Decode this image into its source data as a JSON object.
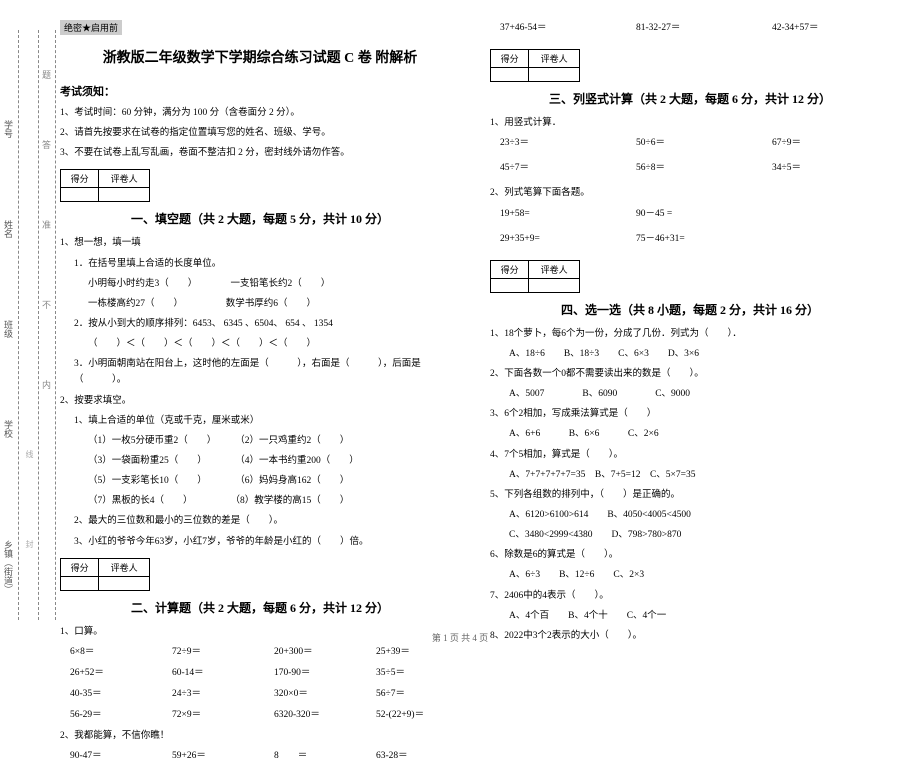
{
  "margin": {
    "township": "乡镇（街道）",
    "school": "学校",
    "class": "班级",
    "name": "姓名",
    "id": "学号",
    "inner": "内",
    "no": "不",
    "zhun": "准",
    "da": "答",
    "ti": "题",
    "feng": "封",
    "xian": "线"
  },
  "secret": "绝密★启用前",
  "title": "浙教版二年级数学下学期综合练习试题 C 卷  附解析",
  "instructions_title": "考试须知：",
  "instructions": [
    "1、考试时间：60 分钟，满分为 100 分（含卷面分 2 分）。",
    "2、请首先按要求在试卷的指定位置填写您的姓名、班级、学号。",
    "3、不要在试卷上乱写乱画，卷面不整洁扣 2 分，密封线外请勿作答。"
  ],
  "scorebox": {
    "c1": "得分",
    "c2": "评卷人"
  },
  "section1": {
    "title": "一、填空题（共 2 大题，每题 5 分，共计 10 分）",
    "q1": "1、想一想，填一填",
    "q1_1": "1．在括号里填上合适的长度单位。",
    "q1_1a": "小明每小时约走3（　　）　　　　一支铅笔长约2（　　）",
    "q1_1b": "一栋楼高约27（　　）　　　　　数学书厚约6（　　）",
    "q1_2": "2．按从小到大的顺序排列：6453、 6345 、6504、 654 、 1354",
    "q1_2a": "（　　）＜（　　）＜（　　）＜（　　）＜（　　）",
    "q1_3": "3．小明面朝南站在阳台上，这时他的左面是（　　　），右面是（　　　），后面是（　　　）。",
    "q2": "2、按要求填空。",
    "q2_1": "1、填上合适的单位（克或千克，厘米或米）",
    "q2_1a": "（1）一枚5分硬币重2（　　）　　　（2）一只鸡重约2（　　）",
    "q2_1b": "（3）一袋面粉重25（　　）　　　　（4）一本书约重200（　　）",
    "q2_1c": "（5）一支彩笔长10（　　）　　　　（6）妈妈身高162（　　）",
    "q2_1d": "（7）黑板的长4（　　）　　　　　（8）教学楼的高15（　　）",
    "q2_2": "2、最大的三位数和最小的三位数的差是（　　）。",
    "q2_3": "3、小红的爷爷今年63岁，小红7岁，爷爷的年龄是小红的（　　）倍。"
  },
  "section2": {
    "title": "二、计算题（共 2 大题，每题 6 分，共计 12 分）",
    "q1": "1、口算。",
    "rows": [
      [
        "6×8＝",
        "72÷9＝",
        "20+300＝",
        "25+39＝"
      ],
      [
        "26+52＝",
        "60-14＝",
        "170-90＝",
        "35÷5＝"
      ],
      [
        "40-35＝",
        "24÷3＝",
        "320×0＝",
        "56÷7＝"
      ],
      [
        "56-29＝",
        "72×9＝",
        "6320-320＝",
        "52-(22+9)＝"
      ]
    ],
    "q2": "2、我都能算，不信你瞧！",
    "r2": [
      "90-47＝",
      "59+26＝",
      "8　　＝",
      "63-28＝"
    ],
    "r3": [
      "37+46-54＝",
      "81-32-27＝",
      "42-34+57＝"
    ]
  },
  "section3": {
    "title": "三、列竖式计算（共 2 大题，每题 6 分，共计 12 分）",
    "q1": "1、用竖式计算．",
    "r1": [
      "23÷3＝",
      "50÷6＝",
      "67÷9＝"
    ],
    "r2": [
      "45÷7＝",
      "56÷8＝",
      "34÷5＝"
    ],
    "q2": "2、列式笔算下面各题。",
    "r3": [
      "19+58=",
      "90－45 ="
    ],
    "r4": [
      "29+35+9=",
      "75－46+31="
    ]
  },
  "section4": {
    "title": "四、选一选（共 8 小题，每题 2 分，共计 16 分）",
    "q": [
      "1、18个萝卜，每6个为一份，分成了几份．列式为（　　）．",
      "　　A、18÷6　　B、18÷3　　C、6×3　　D、3×6",
      "2、下面各数一个0都不需要读出来的数是（　　）。",
      "　　A、5007　　　　B、6090　　　　C、9000",
      "3、6个2相加，写成乘法算式是（　　）",
      "　　A、6+6　　　B、6×6　　　C、2×6",
      "4、7个5相加，算式是（　　）。",
      "　　A、7+7+7+7+7=35　B、7+5=12　C、5×7=35",
      "5、下列各组数的排列中，（　　）是正确的。",
      "　　A、6120>6100>614　　B、4050<4005<4500",
      "　　C、3480<2999<4380　　D、798>780>870",
      "6、除数是6的算式是（　　）。",
      "　　A、6÷3　　B、12÷6　　C、2×3",
      "7、2406中的4表示（　　）。",
      "　　A、4个百　　B、4个十　　C、4个一",
      "8、2022中3个2表示的大小（　　）。"
    ]
  },
  "footer": "第 1 页 共 4 页"
}
